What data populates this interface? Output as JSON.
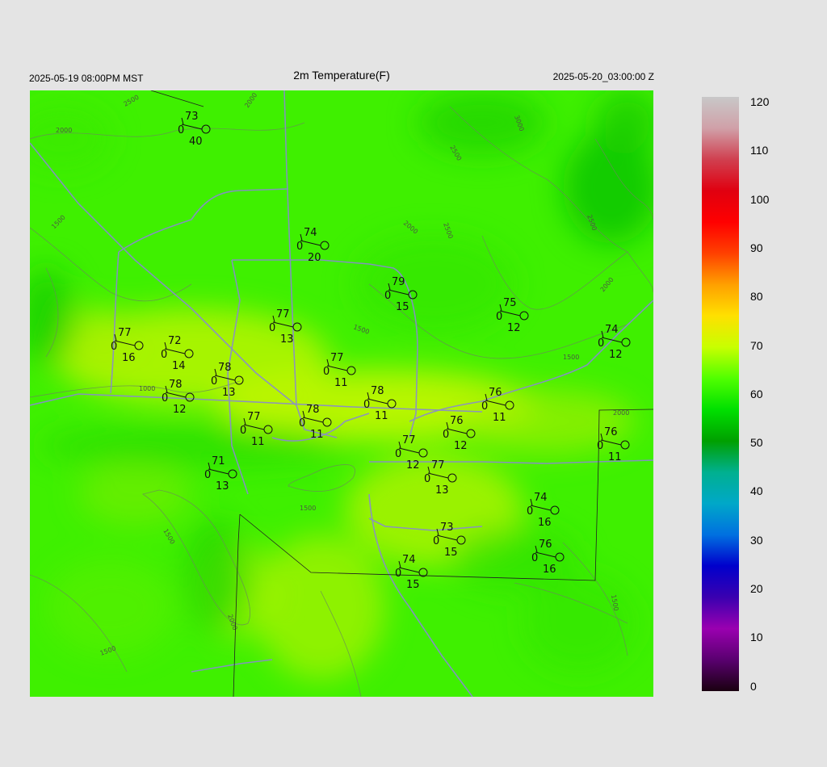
{
  "header": {
    "local_time": "2025-05-19 08:00PM MST",
    "title": "2m Temperature(F)",
    "valid_time": "2025-05-20_03:00:00 Z"
  },
  "contour_labels": [
    "2500",
    "2000",
    "2000",
    "3000",
    "2500",
    "2500",
    "2500",
    "1500",
    "2000",
    "2000",
    "1500",
    "1000",
    "1500",
    "2000",
    "1500",
    "1500",
    "1500",
    "1500",
    "2000"
  ],
  "stations": [
    {
      "temp": "73",
      "cover": "0",
      "dewpt": "40"
    },
    {
      "temp": "74",
      "cover": "0",
      "dewpt": "20"
    },
    {
      "temp": "79",
      "cover": "0",
      "dewpt": "15"
    },
    {
      "temp": "75",
      "cover": "0",
      "dewpt": "12"
    },
    {
      "temp": "74",
      "cover": "0",
      "dewpt": "12"
    },
    {
      "temp": "77",
      "cover": "0",
      "dewpt": "16"
    },
    {
      "temp": "72",
      "cover": "0",
      "dewpt": "14"
    },
    {
      "temp": "77",
      "cover": "0",
      "dewpt": "13"
    },
    {
      "temp": "77",
      "cover": "0",
      "dewpt": "11"
    },
    {
      "temp": "78",
      "cover": "0",
      "dewpt": "13"
    },
    {
      "temp": "78",
      "cover": "0",
      "dewpt": "12"
    },
    {
      "temp": "78",
      "cover": "0",
      "dewpt": "11"
    },
    {
      "temp": "76",
      "cover": "0",
      "dewpt": "11"
    },
    {
      "temp": "78",
      "cover": "0",
      "dewpt": "11"
    },
    {
      "temp": "77",
      "cover": "0",
      "dewpt": "11"
    },
    {
      "temp": "76",
      "cover": "0",
      "dewpt": "12"
    },
    {
      "temp": "76",
      "cover": "0",
      "dewpt": "11"
    },
    {
      "temp": "77",
      "cover": "0",
      "dewpt": "12"
    },
    {
      "temp": "71",
      "cover": "0",
      "dewpt": "13"
    },
    {
      "temp": "77",
      "cover": "0",
      "dewpt": "13"
    },
    {
      "temp": "74",
      "cover": "0",
      "dewpt": "16"
    },
    {
      "temp": "73",
      "cover": "0",
      "dewpt": "15"
    },
    {
      "temp": "76",
      "cover": "0",
      "dewpt": "16"
    },
    {
      "temp": "74",
      "cover": "0",
      "dewpt": "15"
    }
  ],
  "colorbar": {
    "labels": [
      "120",
      "110",
      "100",
      "90",
      "80",
      "70",
      "60",
      "50",
      "40",
      "30",
      "20",
      "10",
      "0"
    ],
    "stops": [
      "#1a0010",
      "#5a0070",
      "#9a00b0",
      "#3a00b0",
      "#0000cc",
      "#0070e0",
      "#00a8c8",
      "#00b090",
      "#00a000",
      "#00e000",
      "#50ff00",
      "#c8ff00",
      "#ffe000",
      "#ffa000",
      "#ff4000",
      "#ff0000",
      "#e00010",
      "#d04050",
      "#d0a0a8",
      "#c8c8c8"
    ]
  }
}
